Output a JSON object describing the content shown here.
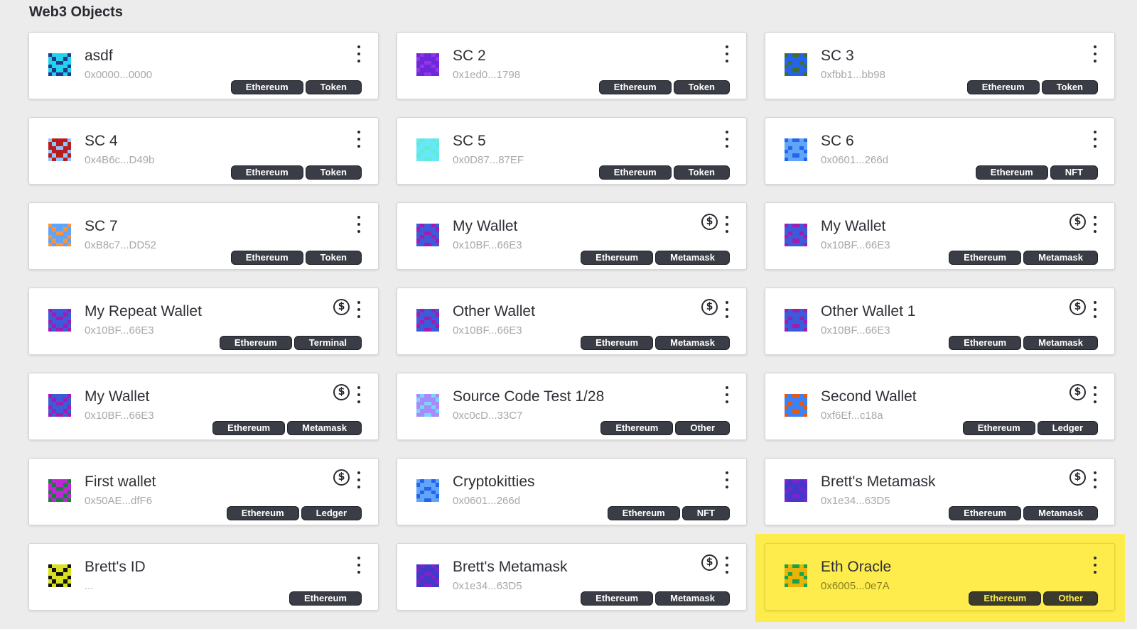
{
  "page": {
    "title": "Web3 Objects"
  },
  "cards": [
    {
      "name": "asdf",
      "address": "0x0000...0000",
      "wallet": false,
      "tags": [
        "Ethereum",
        "Token"
      ],
      "avatar_colors": [
        "#1e3a8a",
        "#22d3ee"
      ]
    },
    {
      "name": "SC 2",
      "address": "0x1ed0...1798",
      "wallet": false,
      "tags": [
        "Ethereum",
        "Token"
      ],
      "avatar_colors": [
        "#9333ea",
        "#6d28d9"
      ]
    },
    {
      "name": "SC 3",
      "address": "0xfbb1...bb98",
      "wallet": false,
      "tags": [
        "Ethereum",
        "Token"
      ],
      "avatar_colors": [
        "#3f6f2a",
        "#2563eb"
      ]
    },
    {
      "name": "SC 4",
      "address": "0x4B6c...D49b",
      "wallet": false,
      "tags": [
        "Ethereum",
        "Token"
      ],
      "avatar_colors": [
        "#93c5fd",
        "#b91c1c"
      ]
    },
    {
      "name": "SC 5",
      "address": "0x0D87...87EF",
      "wallet": false,
      "tags": [
        "Ethereum",
        "Token"
      ],
      "avatar_colors": [
        "#5eead4",
        "#67e8f9"
      ]
    },
    {
      "name": "SC 6",
      "address": "0x0601...266d",
      "wallet": false,
      "tags": [
        "Ethereum",
        "NFT"
      ],
      "avatar_colors": [
        "#2563eb",
        "#60a5fa"
      ]
    },
    {
      "name": "SC 7",
      "address": "0xB8c7...DD52",
      "wallet": false,
      "tags": [
        "Ethereum",
        "Token"
      ],
      "avatar_colors": [
        "#fb923c",
        "#60a5fa"
      ]
    },
    {
      "name": "My Wallet",
      "address": "0x10BF...66E3",
      "wallet": true,
      "tags": [
        "Ethereum",
        "Metamask"
      ],
      "avatar_colors": [
        "#a21caf",
        "#3b5bdb"
      ]
    },
    {
      "name": "My Wallet",
      "address": "0x10BF...66E3",
      "wallet": true,
      "tags": [
        "Ethereum",
        "Metamask"
      ],
      "avatar_colors": [
        "#a21caf",
        "#3b5bdb"
      ]
    },
    {
      "name": "My Repeat Wallet",
      "address": "0x10BF...66E3",
      "wallet": true,
      "tags": [
        "Ethereum",
        "Terminal"
      ],
      "avatar_colors": [
        "#a21caf",
        "#3b5bdb"
      ]
    },
    {
      "name": "Other Wallet",
      "address": "0x10BF...66E3",
      "wallet": true,
      "tags": [
        "Ethereum",
        "Metamask"
      ],
      "avatar_colors": [
        "#a21caf",
        "#3b5bdb"
      ]
    },
    {
      "name": "Other Wallet 1",
      "address": "0x10BF...66E3",
      "wallet": true,
      "tags": [
        "Ethereum",
        "Metamask"
      ],
      "avatar_colors": [
        "#a21caf",
        "#3b5bdb"
      ]
    },
    {
      "name": "My Wallet",
      "address": "0x10BF...66E3",
      "wallet": true,
      "tags": [
        "Ethereum",
        "Metamask"
      ],
      "avatar_colors": [
        "#a21caf",
        "#3b5bdb"
      ]
    },
    {
      "name": "Source Code Test 1/28",
      "address": "0xc0cD...33C7",
      "wallet": false,
      "tags": [
        "Ethereum",
        "Other"
      ],
      "avatar_colors": [
        "#7dd3fc",
        "#a78bfa"
      ]
    },
    {
      "name": "Second Wallet",
      "address": "0xf6Ef...c18a",
      "wallet": true,
      "tags": [
        "Ethereum",
        "Ledger"
      ],
      "avatar_colors": [
        "#ea580c",
        "#3b82f6"
      ]
    },
    {
      "name": "First wallet",
      "address": "0x50AE...dfF6",
      "wallet": true,
      "tags": [
        "Ethereum",
        "Ledger"
      ],
      "avatar_colors": [
        "#15803d",
        "#c026d3"
      ]
    },
    {
      "name": "Cryptokitties",
      "address": "0x0601...266d",
      "wallet": false,
      "tags": [
        "Ethereum",
        "NFT"
      ],
      "avatar_colors": [
        "#2563eb",
        "#60a5fa"
      ]
    },
    {
      "name": "Brett's Metamask",
      "address": "0x1e34...63D5",
      "wallet": true,
      "tags": [
        "Ethereum",
        "Metamask"
      ],
      "avatar_colors": [
        "#7e22ce",
        "#4338ca"
      ]
    },
    {
      "name": "Brett's ID",
      "address": "...",
      "wallet": false,
      "tags": [
        "Ethereum"
      ],
      "avatar_colors": [
        "#111111",
        "#d9e021"
      ]
    },
    {
      "name": "Brett's Metamask",
      "address": "0x1e34...63D5",
      "wallet": true,
      "tags": [
        "Ethereum",
        "Metamask"
      ],
      "avatar_colors": [
        "#7e22ce",
        "#4338ca"
      ]
    },
    {
      "name": "Eth Oracle",
      "address": "0x6005...0e7A",
      "wallet": false,
      "highlighted": true,
      "tags": [
        "Ethereum",
        "Other"
      ],
      "avatar_colors": [
        "#16a34a",
        "#eab308"
      ]
    }
  ],
  "icons": {
    "menu": "kebab-menu-icon",
    "balance": "dollar-circle-icon"
  },
  "colors": {
    "background": "#ececec",
    "card": "#ffffff",
    "tag": "#3a3d45",
    "highlight": "#fdec4c"
  }
}
